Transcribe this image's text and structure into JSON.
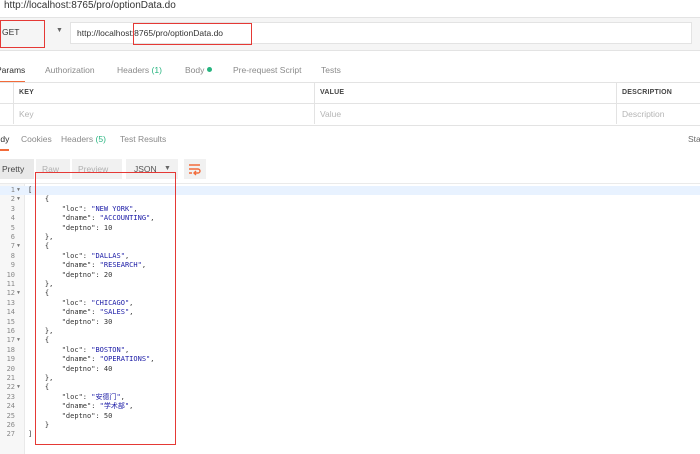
{
  "window": {
    "title": "http://localhost:8765/pro/optionData.do"
  },
  "request": {
    "method": "GET",
    "url": "http://localhost:8765/pro/optionData.do"
  },
  "request_tabs": [
    {
      "label": "Params"
    },
    {
      "label": "Authorization"
    },
    {
      "label": "Headers",
      "count": "(1)"
    },
    {
      "label": "Body"
    },
    {
      "label": "Pre-request Script"
    },
    {
      "label": "Tests"
    }
  ],
  "params_table": {
    "headers": [
      "KEY",
      "VALUE",
      "DESCRIPTION"
    ],
    "placeholders": [
      "Key",
      "Value",
      "Description"
    ]
  },
  "response_tabs": [
    {
      "label": "Body"
    },
    {
      "label": "Cookies"
    },
    {
      "label": "Headers",
      "count": "(5)"
    },
    {
      "label": "Test Results"
    }
  ],
  "response_status_label": "Status",
  "viewer": {
    "modes": [
      "Pretty",
      "Raw",
      "Preview"
    ],
    "format": "JSON"
  },
  "json_body": {
    "items": [
      {
        "loc": "\"NEW YORK\"",
        "dname": "\"ACCOUNTING\"",
        "deptno": "10"
      },
      {
        "loc": "\"DALLAS\"",
        "dname": "\"RESEARCH\"",
        "deptno": "20"
      },
      {
        "loc": "\"CHICAGO\"",
        "dname": "\"SALES\"",
        "deptno": "30"
      },
      {
        "loc": "\"BOSTON\"",
        "dname": "\"OPERATIONS\"",
        "deptno": "40"
      },
      {
        "loc": "\"安德门\"",
        "dname": "\"学术部\"",
        "deptno": "50"
      }
    ]
  },
  "colors": {
    "accent": "#f26b3a",
    "highlight_box": "#e53935",
    "count_green": "#26b47f",
    "json_string": "#1a1aa6"
  }
}
